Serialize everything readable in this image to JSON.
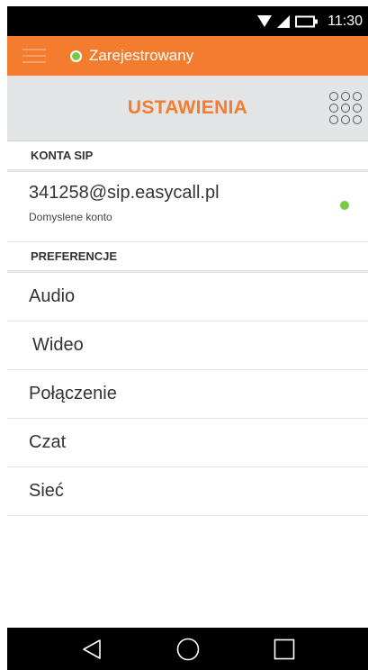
{
  "status_bar": {
    "time": "11:30",
    "icons": [
      "wifi-icon",
      "signal-icon",
      "battery-icon"
    ]
  },
  "registration": {
    "status": "Zarejestrowany",
    "status_color": "#7ac943"
  },
  "header": {
    "title": "USTAWIENIA",
    "icons": [
      "menu-icon",
      "dialpad-icon"
    ]
  },
  "sections": {
    "sip": {
      "title": "KONTA SIP",
      "account": {
        "name": "341258@sip.easycall.pl",
        "subtitle": "Domyslene konto",
        "status_color": "#7ac943"
      }
    },
    "preferences": {
      "title": "PREFERENCJE",
      "items": [
        {
          "label": "Audio"
        },
        {
          "label": "Wideo"
        },
        {
          "label": "Połączenie"
        },
        {
          "label": "Czat"
        },
        {
          "label": "Sieć"
        }
      ]
    }
  },
  "nav": {
    "icons": [
      "back-icon",
      "home-icon",
      "recents-icon"
    ]
  },
  "colors": {
    "accent": "#f47c2e",
    "header_bg": "#e3e4e5",
    "online": "#7ac943"
  }
}
